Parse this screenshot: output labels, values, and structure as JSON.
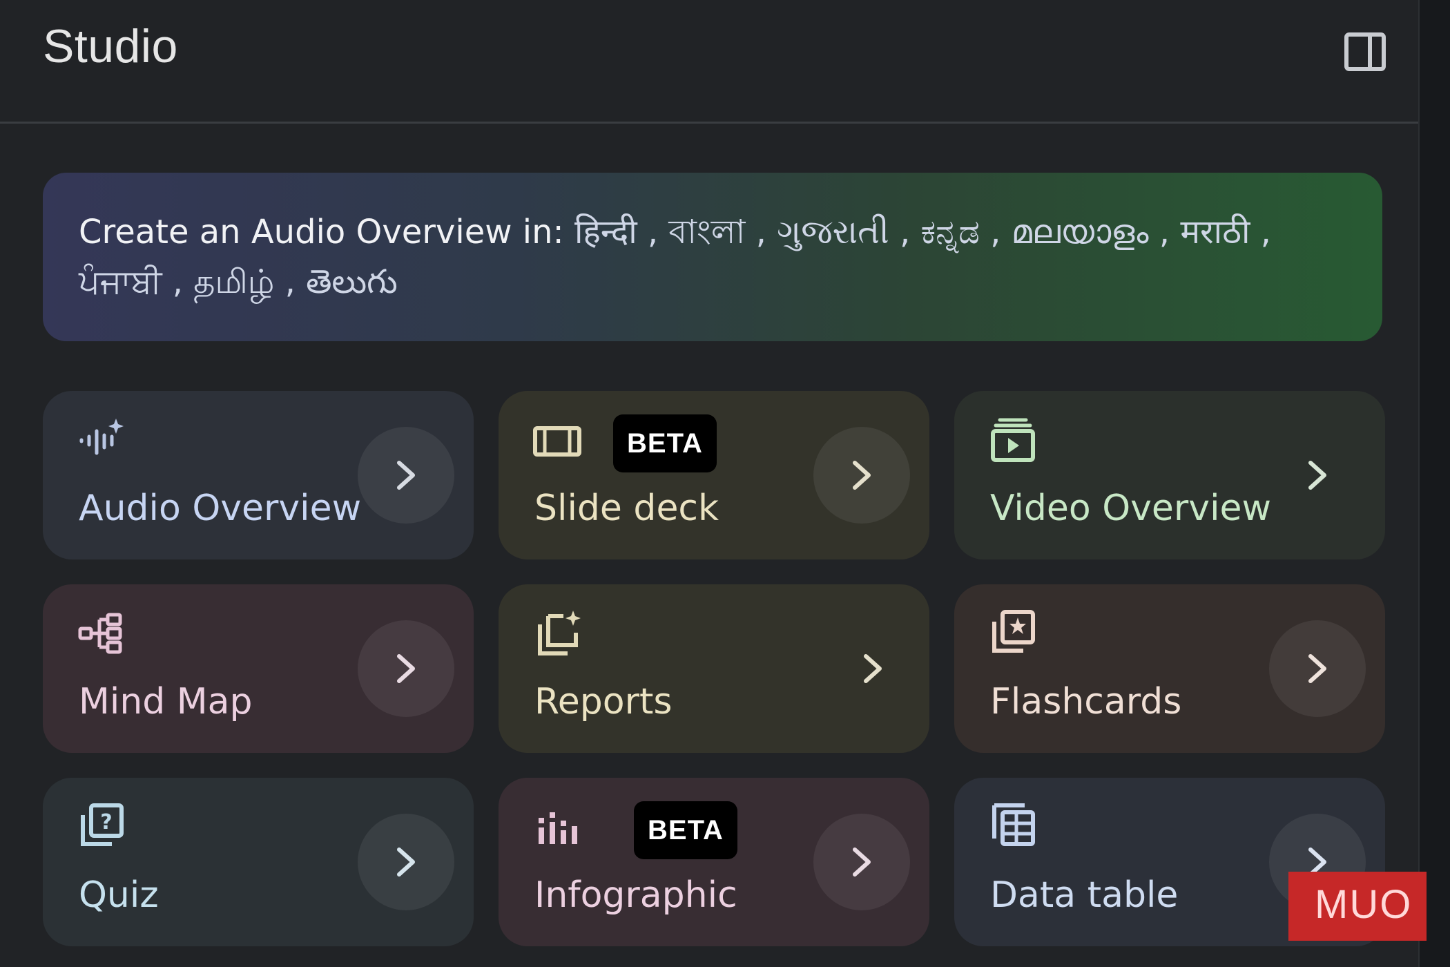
{
  "header": {
    "title": "Studio",
    "collapse_icon": "side-panel-icon"
  },
  "banner": {
    "prefix": "Create an Audio Overview in: ",
    "languages": "हिन्दी , বাংলা , ગુજરાતી , ಕನ್ನಡ , മലയാളം , मराठी , ਪੰਜਾਬੀ , தமிழ் , తెలుగు"
  },
  "tiles": [
    {
      "label": "Audio Overview",
      "icon": "audio-waveform-sparkle-icon",
      "badge": "",
      "theme": "#2d3139"
    },
    {
      "label": "Slide deck",
      "icon": "slides-icon",
      "badge": "BETA",
      "theme": "#33332a"
    },
    {
      "label": "Video Overview",
      "icon": "video-overview-icon",
      "badge": "",
      "theme": "#2b302c"
    },
    {
      "label": "Mind Map",
      "icon": "mind-map-icon",
      "badge": "",
      "theme": "#382d33"
    },
    {
      "label": "Reports",
      "icon": "reports-icon",
      "badge": "",
      "theme": "#33332a"
    },
    {
      "label": "Flashcards",
      "icon": "flashcards-icon",
      "badge": "",
      "theme": "#352e2c"
    },
    {
      "label": "Quiz",
      "icon": "quiz-icon",
      "badge": "",
      "theme": "#2b3135"
    },
    {
      "label": "Infographic",
      "icon": "infographic-icon",
      "badge": "BETA",
      "theme": "#382d33"
    },
    {
      "label": "Data table",
      "icon": "data-table-icon",
      "badge": "",
      "theme": "#2c3039"
    }
  ],
  "watermark": {
    "text": "MUO"
  }
}
